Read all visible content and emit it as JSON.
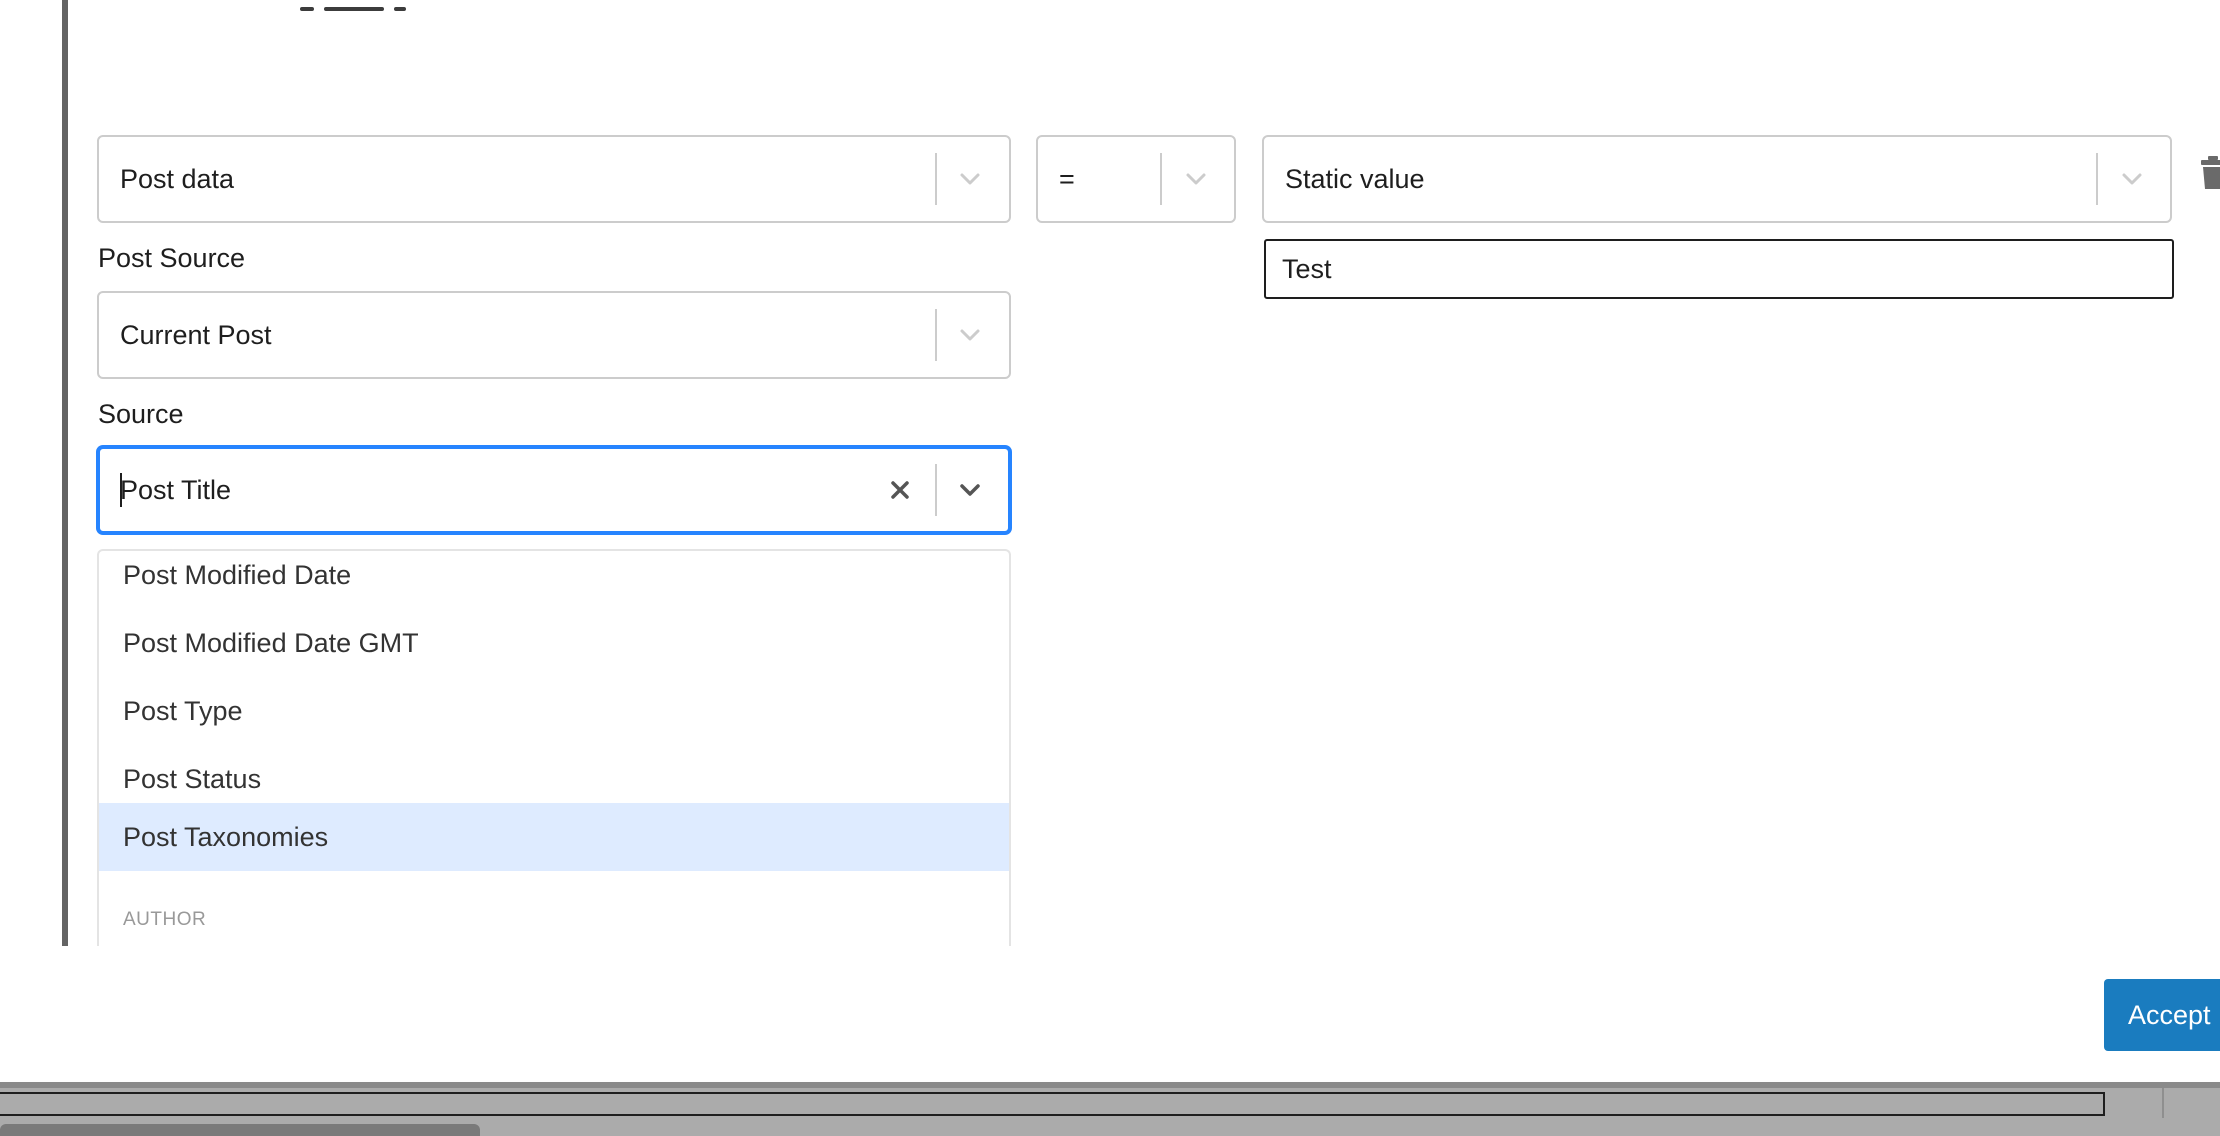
{
  "condition": {
    "field_select": "Post data",
    "operator_select": "=",
    "value_type_select": "Static value",
    "value_input": "Test"
  },
  "post_source": {
    "label": "Post Source",
    "value": "Current Post"
  },
  "source": {
    "label": "Source",
    "value": "Post Title"
  },
  "dropdown": {
    "options": [
      "Post Modified Date",
      "Post Modified Date GMT",
      "Post Type",
      "Post Status",
      "Post Taxonomies"
    ],
    "highlighted": "Post Taxonomies",
    "group_label": "AUTHOR"
  },
  "footer": {
    "accept_label": "Accept"
  },
  "icons": [
    "chevron-down-icon",
    "clear-icon",
    "trash-icon"
  ],
  "colors": {
    "focus": "#2684ff",
    "highlight": "#deebff",
    "accept_button": "#1a7cbf",
    "border": "#cccccc"
  }
}
